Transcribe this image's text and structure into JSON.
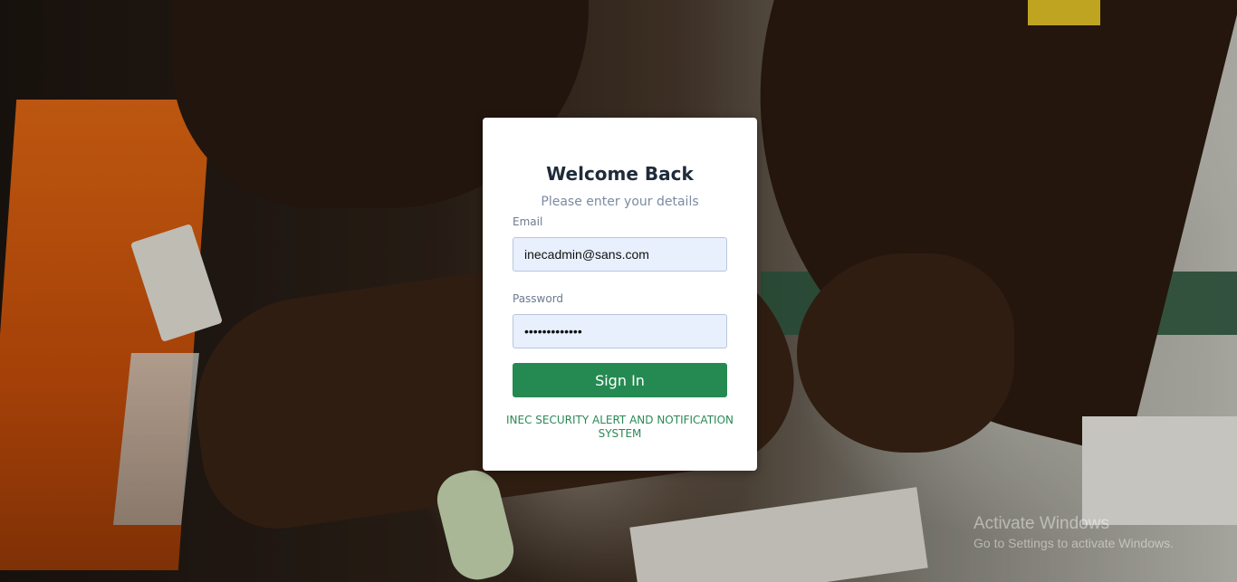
{
  "login": {
    "title": "Welcome Back",
    "subtitle": "Please enter your details",
    "email_label": "Email",
    "email_value": "inecadmin@sans.com",
    "password_label": "Password",
    "password_value": "•••••••••••••",
    "sign_in_label": "Sign In",
    "footer_text": "INEC SECURITY ALERT AND NOTIFICATION SYSTEM"
  },
  "watermark": {
    "line1": "Activate Windows",
    "line2": "Go to Settings to activate Windows."
  },
  "colors": {
    "primary": "#248a51",
    "input_bg": "#e8f0fe",
    "title": "#1f2b3a",
    "subtitle": "#7b8ba3"
  }
}
